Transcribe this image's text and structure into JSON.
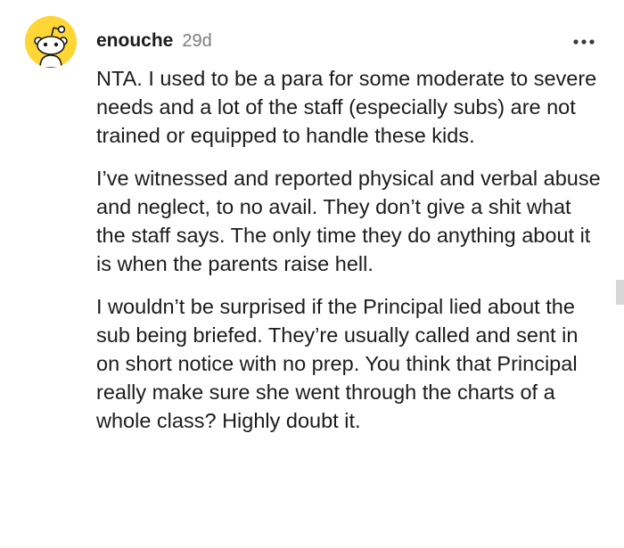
{
  "comment": {
    "author": "enouche",
    "age": "29d",
    "paragraphs": [
      "NTA. I used to be a para for some moderate to severe needs and a lot of the staff (especially subs) are not trained or equipped to handle these kids.",
      "I’ve witnessed and reported physical and verbal abuse and neglect, to no avail. They don’t give a shit what the staff says. The only time they do anything about it is when the parents raise hell.",
      "I wouldn’t be surprised if the Principal lied about the sub being briefed. They’re usually called and sent in on short notice with no prep. You think that Principal really make sure she went through the charts of a whole class? Highly doubt it."
    ],
    "avatar_icon": "snoo-avatar-icon",
    "more_icon": "more-options-icon"
  },
  "colors": {
    "avatar_background": "#ffd635",
    "text": "#1c1c1c",
    "muted": "#7c7c7c"
  }
}
